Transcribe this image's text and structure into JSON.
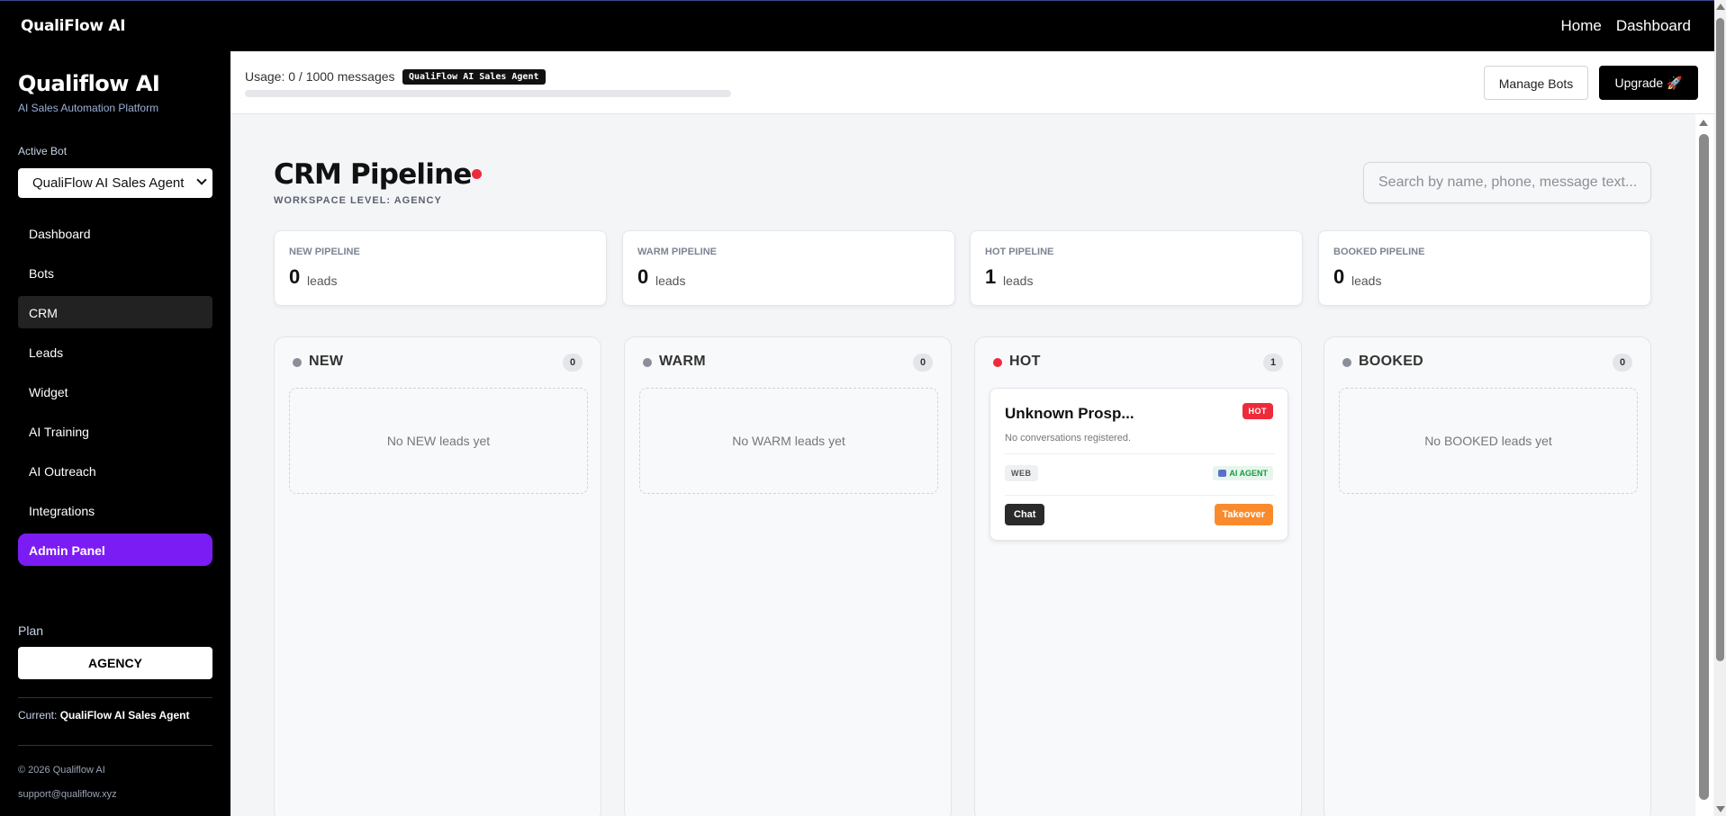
{
  "topbar": {
    "brand": "QualiFlow AI",
    "nav": [
      "Home",
      "Dashboard"
    ]
  },
  "sidebar": {
    "title": "Qualiflow AI",
    "subtitle": "AI Sales Automation Platform",
    "active_bot_label": "Active Bot",
    "active_bot_value": "QualiFlow AI Sales Agent",
    "items": [
      {
        "label": "Dashboard"
      },
      {
        "label": "Bots"
      },
      {
        "label": "CRM",
        "active": true
      },
      {
        "label": "Leads"
      },
      {
        "label": "Widget"
      },
      {
        "label": "AI Training"
      },
      {
        "label": "AI Outreach"
      },
      {
        "label": "Integrations"
      },
      {
        "label": "Admin Panel"
      }
    ],
    "plan_label": "Plan",
    "plan_value": "AGENCY",
    "current_label": "Current:",
    "current_value": "QualiFlow AI Sales Agent",
    "copyright": "© 2026 Qualiflow AI",
    "support": "support@qualiflow.xyz"
  },
  "header": {
    "usage_text": "Usage: 0 / 1000 messages",
    "agent_tag": "QualiFlow AI Sales Agent",
    "usage_fraction": 0,
    "manage_bots": "Manage Bots",
    "upgrade": "Upgrade 🚀"
  },
  "main": {
    "title": "CRM Pipeline",
    "workspace": "WORKSPACE LEVEL: AGENCY",
    "search_placeholder": "Search by name, phone, message text...",
    "stats": [
      {
        "label": "NEW PIPELINE",
        "value": "0",
        "unit": "leads"
      },
      {
        "label": "WARM PIPELINE",
        "value": "0",
        "unit": "leads"
      },
      {
        "label": "HOT PIPELINE",
        "value": "1",
        "unit": "leads"
      },
      {
        "label": "BOOKED PIPELINE",
        "value": "0",
        "unit": "leads"
      }
    ],
    "columns": [
      {
        "name": "NEW",
        "count": "0",
        "empty": "No NEW leads yet"
      },
      {
        "name": "WARM",
        "count": "0",
        "empty": "No WARM leads yet"
      },
      {
        "name": "HOT",
        "count": "1"
      },
      {
        "name": "BOOKED",
        "count": "0",
        "empty": "No BOOKED leads yet"
      }
    ],
    "hot_card": {
      "name": "Unknown Prosp...",
      "badge": "HOT",
      "desc": "No conversations registered.",
      "source": "WEB",
      "agent": "AI AGENT",
      "chat": "Chat",
      "takeover": "Takeover"
    }
  },
  "colors": {
    "accent_purple": "#7c1cf5",
    "hot_red": "#ee2b3b",
    "takeover_orange": "#f98b2c",
    "dot_grey": "#8a8f98",
    "ai_green": "#179a43"
  }
}
